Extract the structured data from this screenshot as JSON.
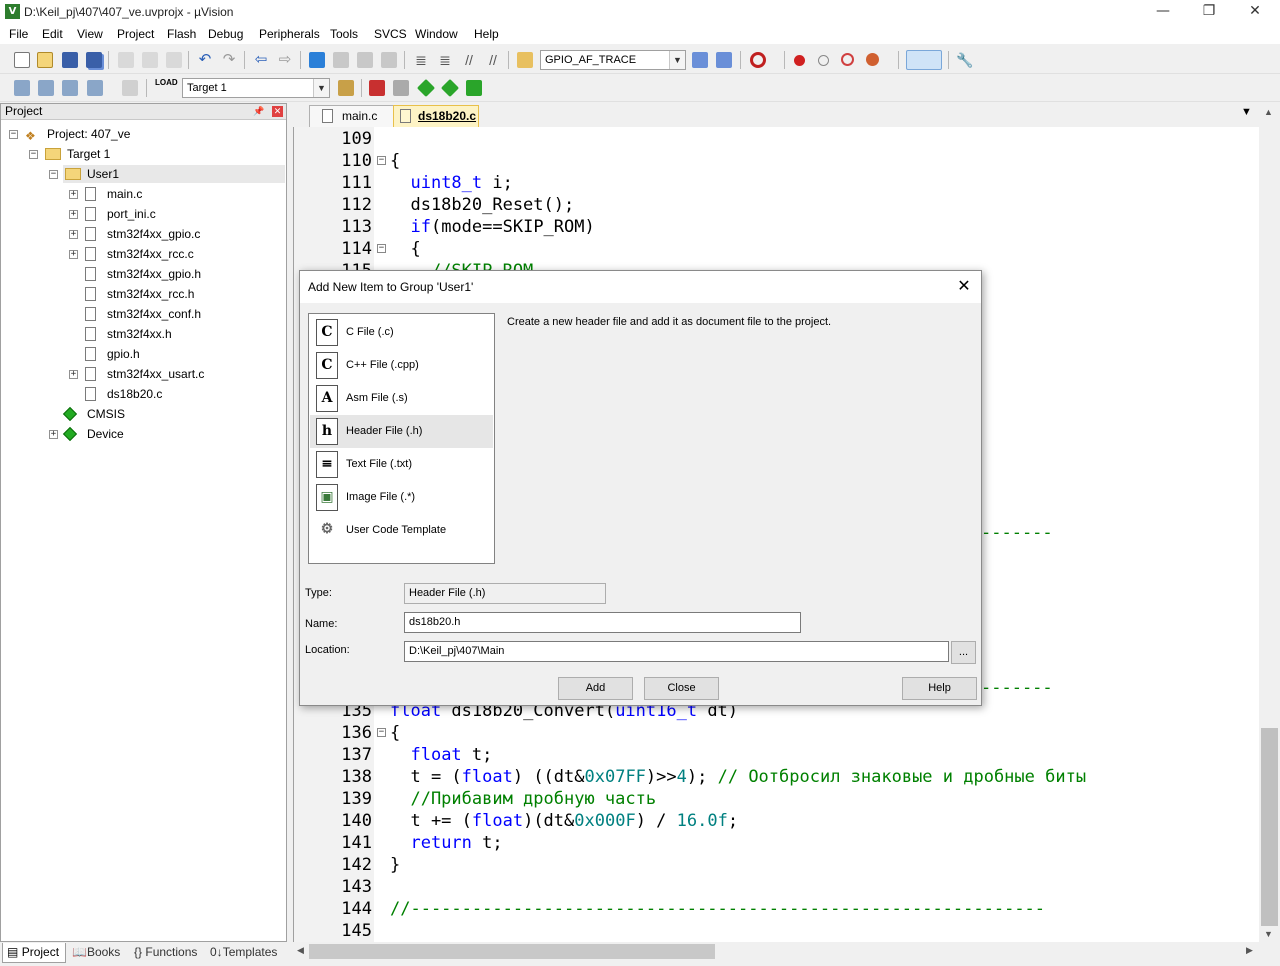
{
  "window": {
    "title": "D:\\Keil_pj\\407\\407_ve.uvprojx - µVision",
    "minimize": "—",
    "restore": "❐",
    "close": "✕"
  },
  "menu": [
    "File",
    "Edit",
    "View",
    "Project",
    "Flash",
    "Debug",
    "Peripherals",
    "Tools",
    "SVCS",
    "Window",
    "Help"
  ],
  "toolbar1": {
    "find_combo": "GPIO_AF_TRACE"
  },
  "toolbar2": {
    "target_combo": "Target 1"
  },
  "project_panel": {
    "title": "Project",
    "tree": [
      {
        "label": "Project: 407_ve"
      },
      {
        "label": "Target 1"
      },
      {
        "label": "User1"
      },
      {
        "label": "main.c"
      },
      {
        "label": "port_ini.c"
      },
      {
        "label": "stm32f4xx_gpio.c"
      },
      {
        "label": "stm32f4xx_rcc.c"
      },
      {
        "label": "stm32f4xx_gpio.h"
      },
      {
        "label": "stm32f4xx_rcc.h"
      },
      {
        "label": "stm32f4xx_conf.h"
      },
      {
        "label": "stm32f4xx.h"
      },
      {
        "label": "gpio.h"
      },
      {
        "label": "stm32f4xx_usart.c"
      },
      {
        "label": "ds18b20.c"
      },
      {
        "label": "CMSIS"
      },
      {
        "label": "Device"
      }
    ],
    "tabs": [
      "Project",
      "Books",
      "Functions",
      "Templates"
    ],
    "tab_icons": [
      "▤",
      "📖",
      "{}",
      "0↓"
    ]
  },
  "editor": {
    "tabs": [
      "main.c",
      "ds18b20.c"
    ],
    "active_tab": "ds18b20.c",
    "lines": [
      {
        "n": "109",
        "code": ""
      },
      {
        "n": "110",
        "code": "{"
      },
      {
        "n": "111",
        "code": "  uint8_t i;"
      },
      {
        "n": "112",
        "code": "  ds18b20_Reset();"
      },
      {
        "n": "113",
        "code": "  if(mode==SKIP_ROM)"
      },
      {
        "n": "114",
        "code": "  {"
      },
      {
        "n": "115",
        "code": "    //SKIP ROM"
      },
      {
        "n": "135",
        "code": "float ds18b20_Convert(uint16_t dt)"
      },
      {
        "n": "136",
        "code": "{"
      },
      {
        "n": "137",
        "code": "  float t;"
      },
      {
        "n": "138",
        "code": "  t = (float) ((dt&0x07FF)>>4); // Оотбросил знаковые и дробные биты"
      },
      {
        "n": "139",
        "code": "  //Прибавим дробную часть"
      },
      {
        "n": "140",
        "code": "  t += (float)(dt&0x000F) / 16.0f;"
      },
      {
        "n": "141",
        "code": "  return t;"
      },
      {
        "n": "142",
        "code": "}"
      },
      {
        "n": "143",
        "code": ""
      },
      {
        "n": "144",
        "code": "//--------------------------------------------------------------"
      },
      {
        "n": "145",
        "code": ""
      }
    ],
    "dash_fragment": "-------"
  },
  "dialog": {
    "title": "Add New Item to Group 'User1'",
    "file_types": [
      {
        "label": "C File (.c)",
        "glyph": "C"
      },
      {
        "label": "C++ File (.cpp)",
        "glyph": "C"
      },
      {
        "label": "Asm File (.s)",
        "glyph": "A"
      },
      {
        "label": "Header File (.h)",
        "glyph": "h"
      },
      {
        "label": "Text File (.txt)",
        "glyph": "≡"
      },
      {
        "label": "Image File (.*)",
        "glyph": "▣"
      },
      {
        "label": "User Code Template",
        "glyph": "⚙"
      }
    ],
    "selected_type": "Header File (.h)",
    "description": "Create a new header file and add it as document file to the project.",
    "type_label": "Type:",
    "type_value": "Header File (.h)",
    "name_label": "Name:",
    "name_value": "ds18b20.h",
    "location_label": "Location:",
    "location_value": "D:\\Keil_pj\\407\\Main",
    "browse": "...",
    "add": "Add",
    "close": "Close",
    "help": "Help"
  }
}
